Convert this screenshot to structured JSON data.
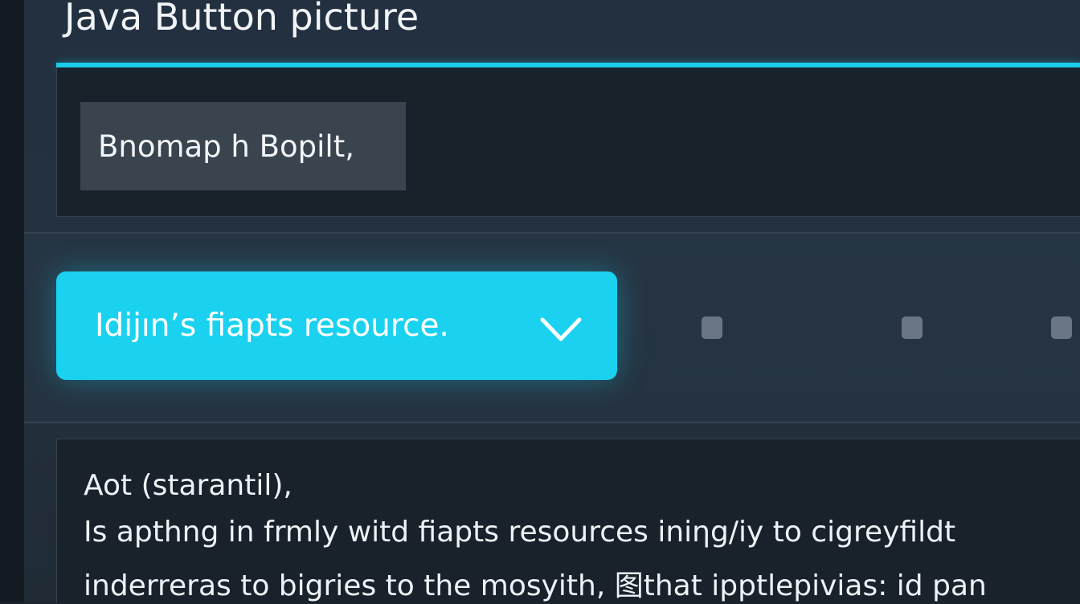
{
  "window": {
    "title": "Java Button picture"
  },
  "top_panel": {
    "label": "Bnomap h Bopilt,"
  },
  "dropdown": {
    "label": "Idijın’s fiapts resource.",
    "icon": "chevron-down-icon"
  },
  "content": {
    "lines": [
      "Aot (starantil),",
      "Is apthng in frmly  witd fiapts resources iniηg/iy to cigreyfildt",
      "inderreras to bigries to the mosyith, 图that ipptlepivias: id pan"
    ]
  },
  "colors": {
    "accent": "#19cde9",
    "background": "#1b232d",
    "label_box": "#39444f",
    "dots": "#6a7684"
  }
}
